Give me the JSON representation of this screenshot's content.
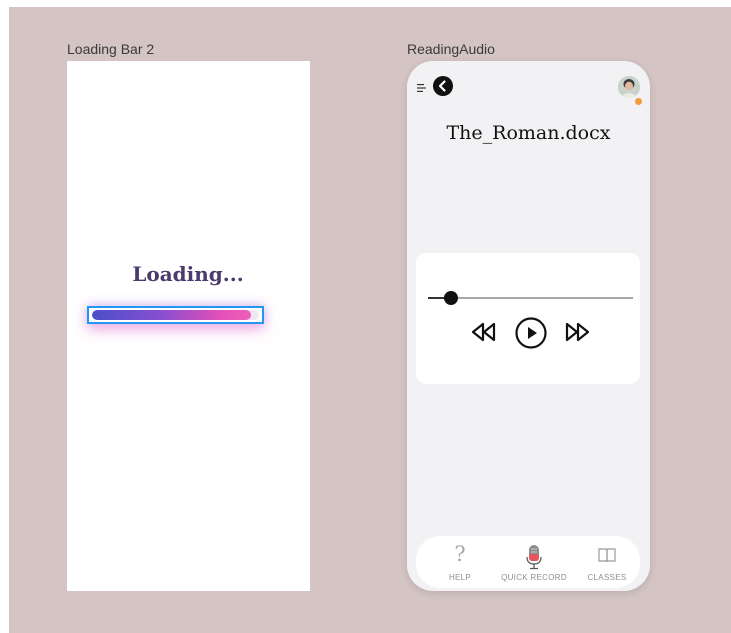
{
  "frames": {
    "loading": {
      "label": "Loading Bar 2",
      "loading_text": "Loading...",
      "progress_fraction": 0.95
    },
    "reading": {
      "label": "ReadingAudio",
      "doc_title": "The_Roman.docx",
      "playback_position_fraction": 0.11,
      "tabs": [
        {
          "label": "HELP",
          "icon": "question-icon"
        },
        {
          "label": "QUICK RECORD",
          "icon": "microphone-icon"
        },
        {
          "label": "CLASSES",
          "icon": "book-icon"
        }
      ]
    }
  },
  "colors": {
    "canvas": "#d4c4c4",
    "selection": "#2196f3",
    "gradient_start": "#4b4fc8",
    "gradient_end": "#ef5fb6",
    "mic_accent": "#e9545b",
    "avatar_status": "#f39a3a"
  }
}
